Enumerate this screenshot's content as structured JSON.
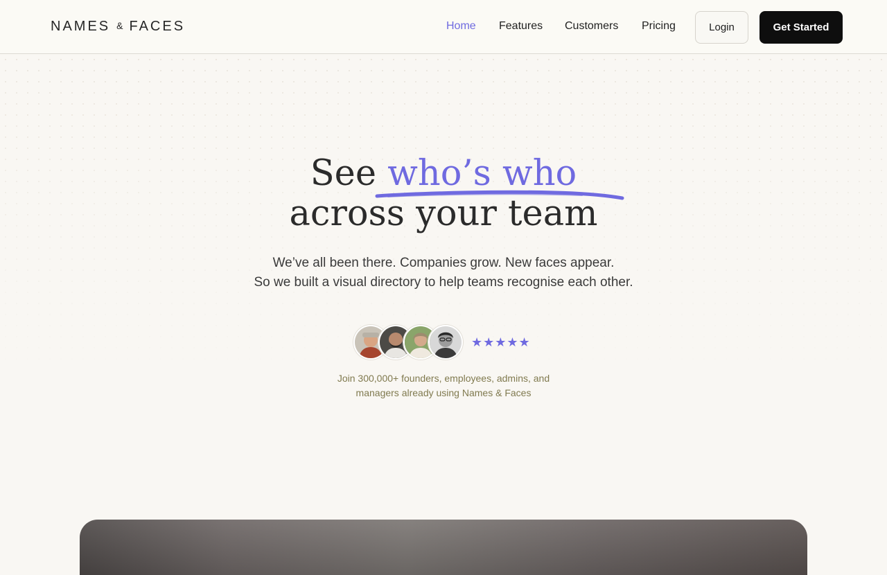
{
  "brand": {
    "name_left": "NAMES",
    "name_amp": "&",
    "name_right": "FACES"
  },
  "nav": {
    "items": [
      {
        "label": "Home",
        "active": true
      },
      {
        "label": "Features",
        "active": false
      },
      {
        "label": "Customers",
        "active": false
      },
      {
        "label": "Pricing",
        "active": false
      }
    ],
    "login_label": "Login",
    "cta_label": "Get Started"
  },
  "hero": {
    "title_prefix": "See ",
    "title_accent": "who’s who",
    "title_line2": "across your team",
    "subtitle_line1": "We’ve all been there. Companies grow. New faces appear.",
    "subtitle_line2": "So we built a visual directory to help teams recognise each other."
  },
  "social_proof": {
    "stars": "★★★★★",
    "rating": 5,
    "text_line1": "Join 300,000+ founders, employees, admins, and",
    "text_line2": "managers already using Names & Faces"
  },
  "colors": {
    "accent": "#6f6ae0",
    "background": "#f9f7f3",
    "cta_background": "#0e0e0e"
  }
}
